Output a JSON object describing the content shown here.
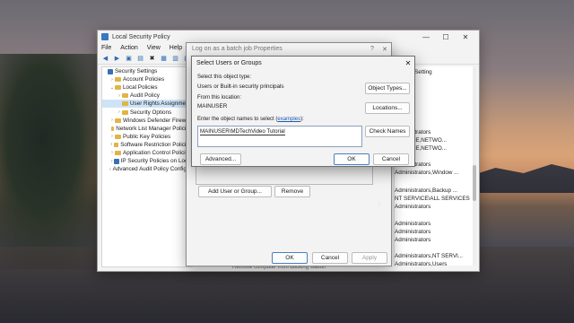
{
  "main_window": {
    "title": "Local Security Policy",
    "menu": [
      "File",
      "Action",
      "View",
      "Help"
    ],
    "controls": {
      "minimize": "—",
      "maximize": "☐",
      "close": "✕"
    },
    "tree": [
      {
        "label": "Security Settings",
        "expander": "",
        "icon": "shield"
      },
      {
        "label": "Account Policies",
        "expander": "›",
        "icon": "folder"
      },
      {
        "label": "Local Policies",
        "expander": "⌄",
        "icon": "folder"
      },
      {
        "label": "Audit Policy",
        "expander": "›",
        "icon": "folder"
      },
      {
        "label": "User Rights Assignment",
        "expander": "",
        "icon": "folder",
        "selected": true
      },
      {
        "label": "Security Options",
        "expander": "›",
        "icon": "folder"
      },
      {
        "label": "Windows Defender Firewall",
        "expander": "›",
        "icon": "folder"
      },
      {
        "label": "Network List Manager Policies",
        "expander": "",
        "icon": "folder"
      },
      {
        "label": "Public Key Policies",
        "expander": "›",
        "icon": "folder"
      },
      {
        "label": "Software Restriction Policies",
        "expander": "›",
        "icon": "folder"
      },
      {
        "label": "Application Control Policies",
        "expander": "›",
        "icon": "folder"
      },
      {
        "label": "IP Security Policies on Local",
        "expander": "›",
        "icon": "shield"
      },
      {
        "label": "Advanced Audit Policy Configuration",
        "expander": "›",
        "icon": "folder"
      }
    ],
    "right_panel": {
      "header": "Setting",
      "rows": [
        "Administrators",
        "SERVICE,NETWO...",
        "SERVICE,NETWO...",
        "Administrators",
        "Administrators,Window ...",
        "Administrators,Backup ...",
        "NT SERVICE\\ALL SERVICES",
        "Administrators",
        "Administrators",
        "Administrators",
        "Administrators",
        "Administrators,NT SERVI...",
        "Administrators,Users"
      ]
    },
    "status_text": "Remove computer from docking station"
  },
  "props_dialog": {
    "title": "Log on as a batch job Properties",
    "help": "?",
    "close": "✕",
    "add_button": "Add User or Group...",
    "remove_button": "Remove",
    "ok": "OK",
    "cancel": "Cancel",
    "apply": "Apply"
  },
  "select_dialog": {
    "title": "Select Users or Groups",
    "close": "✕",
    "object_type_label": "Select this object type:",
    "object_type_value": "Users or Built-in security principals",
    "object_types_button": "Object Types...",
    "location_label": "From this location:",
    "location_value": "MAINUSER",
    "locations_button": "Locations...",
    "names_label_prefix": "Enter the object names to select (",
    "names_label_link": "examples",
    "names_label_suffix": "):",
    "names_value": "MAINUSER\\MDTechVideo Tutorial",
    "check_names_button": "Check Names",
    "advanced_button": "Advanced...",
    "ok": "OK",
    "cancel": "Cancel"
  }
}
